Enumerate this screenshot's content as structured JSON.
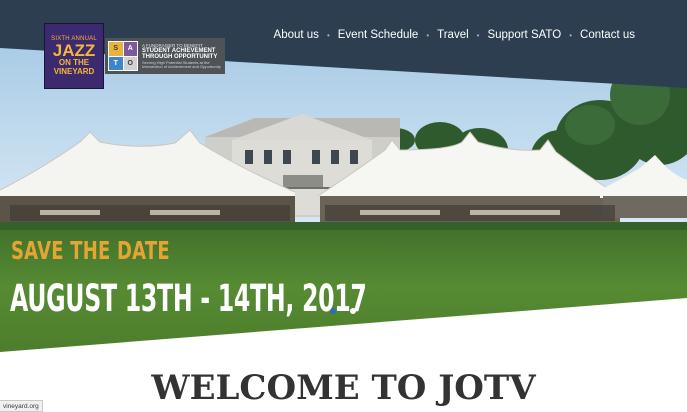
{
  "nav": {
    "items": [
      {
        "label": "About us"
      },
      {
        "label": "Event Schedule"
      },
      {
        "label": "Travel"
      },
      {
        "label": "Support SATO"
      },
      {
        "label": "Contact us"
      }
    ],
    "separator": "•"
  },
  "logos": {
    "jotv": {
      "line1": "SIXTH ANNUAL",
      "line2a": "JAZZ",
      "line2b": "ON THE",
      "line3": "VINEYARD"
    },
    "sato": {
      "letters": [
        "S",
        "A",
        "T",
        "O"
      ],
      "line1": "A FUNDRAISER TO BENEFIT",
      "line2a": "STUDENT ACHIEVEMENT",
      "line2b": "THROUGH OPPORTUNITY",
      "line3a": "Serving High Potential Students at the",
      "line3b": "Intersection of Achievement and Opportunity"
    }
  },
  "hero": {
    "save_the_date": "SAVE THE DATE",
    "dates": "AUGUST 13TH - 14TH, 2017",
    "slider_dots": [
      {
        "state": "active"
      },
      {
        "state": "inactive"
      }
    ]
  },
  "welcome": {
    "title": "WELCOME TO JOTV"
  },
  "status_bar": {
    "url": "vineyard.org"
  },
  "colors": {
    "header_bg": "#2c3e4f",
    "accent_gold": "#e5a534",
    "dot_active": "#2a6fb3",
    "text_dark": "#333333"
  }
}
